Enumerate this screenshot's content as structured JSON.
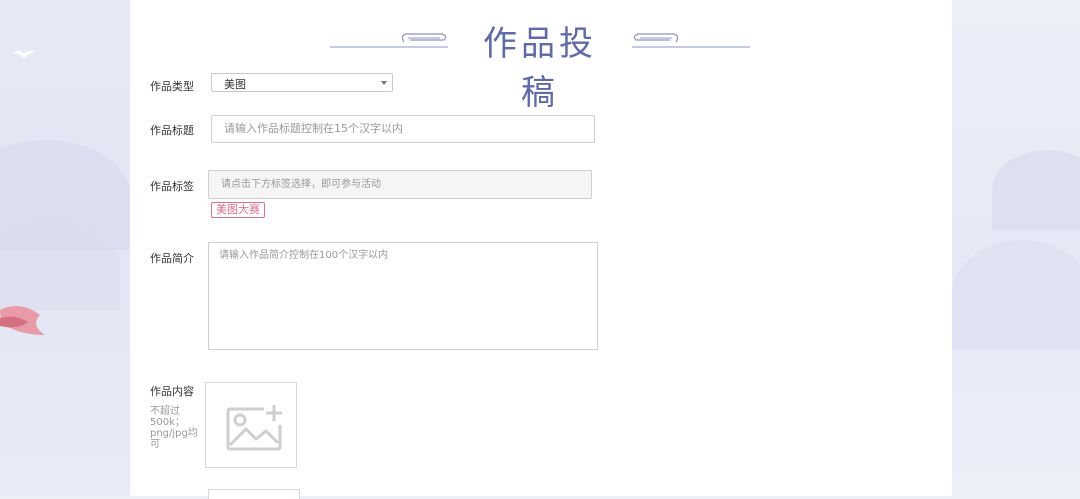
{
  "title": "作品投稿",
  "form": {
    "type": {
      "label": "作品类型",
      "value": "美图"
    },
    "heading": {
      "label": "作品标题",
      "placeholder": "请输入作品标题控制在15个汉字以内"
    },
    "tags": {
      "label": "作品标签",
      "placeholder": "请点击下方标签选择，即可参与活动",
      "tag": "美图大赛"
    },
    "intro": {
      "label": "作品简介",
      "placeholder": "请输入作品简介控制在100个汉字以内"
    },
    "content": {
      "label": "作品内容",
      "hint": "不超过500k；png/jpg均可",
      "upload_icon": "image-add-icon"
    }
  },
  "colors": {
    "accent": "#5f6aa6",
    "tag": "#e06f8e",
    "background": "#eceef8"
  }
}
